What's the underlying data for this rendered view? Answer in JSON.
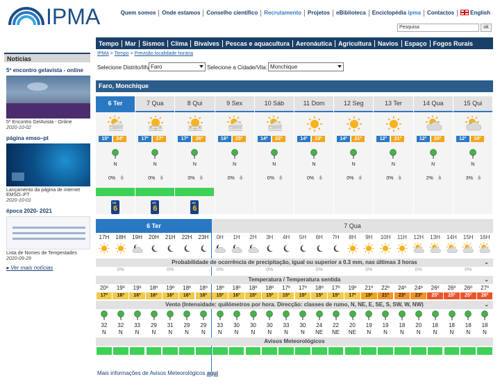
{
  "brand": {
    "logo_text": "IPMA"
  },
  "topnav": {
    "items": [
      "Quem somos",
      "Onde estamos",
      "Conselho científico",
      "Recrutamento",
      "Projetos",
      "eBiblioteca",
      "Enciclopédia",
      "Contactos"
    ],
    "ipma_suffix": "ipma",
    "lang": "English"
  },
  "search": {
    "value": "Pesquisa",
    "ok": "ok"
  },
  "mainnav": {
    "items": [
      "Tempo",
      "Mar",
      "Sismos",
      "Clima",
      "Bivalves",
      "Pescas e aquacultura",
      "Aeronáutica",
      "Agricultura",
      "Navios",
      "Espaço",
      "Fogos Rurais"
    ]
  },
  "sidebar": {
    "title": "Notícias",
    "news": [
      {
        "heading": "5º encontro gelavista - online",
        "caption": "5º Encontro GelAvista - Online",
        "date": "2020-10-02"
      },
      {
        "heading": "página emso–pt",
        "caption": "Lançamento da página de internet EMSO–PT",
        "date": "2020-10-01"
      },
      {
        "heading": "época 2020- 2021",
        "caption": "Lista de Nomes de Tempestades",
        "date": "2020-09-29"
      }
    ],
    "more": "Ver mais notícias"
  },
  "breadcrumb": {
    "a": "IPMA",
    "b": "Tempo",
    "c": "Previsão localidade horária",
    "sep": " > "
  },
  "selectors": {
    "district_label": "Selecione Distrito/Ilha:",
    "district": "Faro",
    "city_label": "Selecione a Cidade/Vila:",
    "city": "Monchique"
  },
  "location": "Faro, Monchique",
  "colors": {
    "nav": "#1b4068",
    "selected": "#2a78c2",
    "tmax": "#f2a51f",
    "green": "#3fd056",
    "red": "#e8562a"
  },
  "days": [
    {
      "label": "6 Ter",
      "min": "15º",
      "max": "24º",
      "dir": "N",
      "prec": "0%",
      "icon": "sun-cloud-hazy",
      "uv": true
    },
    {
      "label": "7 Qua",
      "min": "17º",
      "max": "27º",
      "dir": "N",
      "prec": "0%",
      "icon": "sun-hazy",
      "uv": true
    },
    {
      "label": "8 Qui",
      "min": "17º",
      "max": "26º",
      "dir": "N",
      "prec": "0%",
      "icon": "sun-hazy",
      "uv": true
    },
    {
      "label": "9 Sex",
      "min": "16º",
      "max": "25º",
      "dir": "N",
      "prec": "0%",
      "icon": "sun-cloud-hazy"
    },
    {
      "label": "10 Sáb",
      "min": "14º",
      "max": "23º",
      "dir": "N",
      "prec": "0%",
      "icon": "sun-cloud-hazy"
    },
    {
      "label": "11 Dom",
      "min": "14º",
      "max": "23º",
      "dir": "N",
      "prec": "0%",
      "icon": "sun"
    },
    {
      "label": "12 Seg",
      "min": "14º",
      "max": "21º",
      "dir": "N",
      "prec": "0%",
      "icon": "sun"
    },
    {
      "label": "13 Ter",
      "min": "12º",
      "max": "21º",
      "dir": "N",
      "prec": "0%",
      "icon": "sun"
    },
    {
      "label": "14 Qua",
      "min": "12º",
      "max": "20º",
      "dir": "N",
      "prec": "2%",
      "icon": "sun-cloud"
    },
    {
      "label": "15 Qui",
      "min": "12º",
      "max": "19º",
      "dir": "N",
      "prec": "3%",
      "icon": "sun-cloud"
    }
  ],
  "hourly": {
    "day1": "6 Ter",
    "day2": "7 Qua",
    "hours": [
      "17H",
      "18H",
      "19H",
      "20H",
      "21H",
      "22H",
      "23H",
      "0H",
      "1H",
      "2H",
      "3H",
      "4H",
      "5H",
      "6H",
      "7H",
      "8H",
      "9H",
      "10H",
      "11H",
      "12H",
      "13H",
      "14H",
      "15H",
      "16H"
    ],
    "icons": [
      "sun",
      "sun",
      "moon-cloud",
      "moon",
      "moon",
      "moon",
      "moon",
      "moon-cloud",
      "moon-cloud",
      "moon-cloud",
      "moon",
      "moon",
      "moon",
      "moon",
      "moon",
      "sun",
      "sun",
      "sun",
      "sun",
      "sun-cloud",
      "sun-cloud",
      "sun-cloud",
      "sun-cloud",
      "sun-cloud"
    ],
    "prec_label": "Probabilidade de ocorrência de precipitação, igual ou superior a 0.3 mm, nas últimas 3 horas",
    "prec": [
      "0%",
      "0%",
      "0%",
      "0%",
      "0%",
      "0%",
      "0%",
      "0%"
    ],
    "temp_label": "Temperatura / Temperatura sentida",
    "temp": [
      "20º",
      "19º",
      "19º",
      "18º",
      "19º",
      "18º",
      "18º",
      "18º",
      "18º",
      "18º",
      "18º",
      "17º",
      "17º",
      "18º",
      "17º",
      "19º",
      "21º",
      "22º",
      "24º",
      "24º",
      "26º",
      "26º",
      "26º",
      "27º"
    ],
    "feel": [
      "17º",
      "16º",
      "16º",
      "16º",
      "16º",
      "16º",
      "16º",
      "15º",
      "16º",
      "15º",
      "15º",
      "15º",
      "15º",
      "15º",
      "15º",
      "17º",
      "19º",
      "21º",
      "23º",
      "23º",
      "25º",
      "25º",
      "25º",
      "26º"
    ],
    "wind_label": "Vento (Intensidade: quilómetros por hora. Direcção: classes de rumo, N, NE, E, SE, S, SW, W, NW)",
    "wind_speed": [
      "32",
      "32",
      "33",
      "29",
      "31",
      "29",
      "29",
      "33",
      "30",
      "30",
      "30",
      "33",
      "30",
      "24",
      "22",
      "20",
      "19",
      "19",
      "18",
      "20",
      "18",
      "18",
      "18",
      "18"
    ],
    "wind_dir": [
      "N",
      "N",
      "N",
      "N",
      "N",
      "N",
      "N",
      "N",
      "N",
      "N",
      "N",
      "N",
      "N",
      "NE",
      "NE",
      "NE",
      "N",
      "N",
      "N",
      "N",
      "N",
      "N",
      "N",
      "N"
    ],
    "avisos_label": "Avisos Meteorológicos"
  },
  "footer": {
    "text": "Mais informações de Avisos Meteorológicos ",
    "link": "aqui"
  }
}
